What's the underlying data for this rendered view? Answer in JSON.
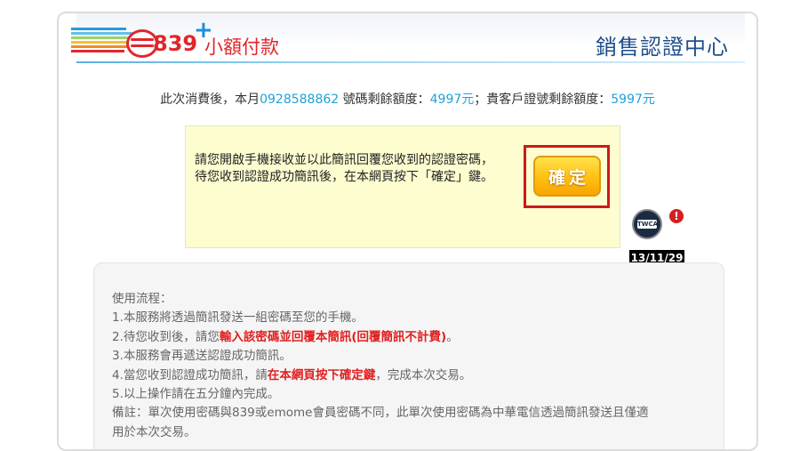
{
  "header": {
    "logo_number": "839",
    "logo_plus": "+",
    "logo_text": "小額付款",
    "title": "銷售認證中心"
  },
  "summary": {
    "prefix": "此次消費後，本月",
    "phone": "0928588862",
    "mid1": " 號碼剩餘額度：",
    "phone_remaining": "4997",
    "currency1": "元",
    "mid2": "；貴客戶證號剩餘額度：",
    "id_remaining": "5997",
    "currency2": "元"
  },
  "notice": {
    "line1": "請您開啟手機接收並以此簡訊回覆您收到的認證密碼，",
    "line2": "待您收到認證成功簡訊後，在本網頁按下「確定」鍵。",
    "confirm_label": "確定"
  },
  "badge": {
    "seal_text": "TWCA",
    "alert": "!",
    "date": "13/11/29"
  },
  "process": {
    "title": "使用流程：",
    "step1": "1.本服務將透過簡訊發送一組密碼至您的手機。",
    "step2_prefix": "2.待您收到後，請您",
    "step2_highlight": "輸入該密碼並回覆本簡訊(回覆簡訊不計費)",
    "step2_suffix": "。",
    "step3": "3.本服務會再遞送認證成功簡訊。",
    "step4_prefix": "4.當您收到認證成功簡訊，請",
    "step4_highlight": "在本網頁按下確定鍵",
    "step4_suffix": "，完成本次交易。",
    "step5": "5.以上操作請在五分鐘內完成。",
    "note_line1": "備註：單次使用密碼與839或emome會員密碼不同，此單次使用密碼為中華電信透過簡訊發送且僅適",
    "note_line2": "用於本次交易。"
  },
  "colors": {
    "brand_red": "#e1262c",
    "brand_blue": "#1e8fd8",
    "title_blue": "#1f4f8c",
    "highlight_red": "#e02020",
    "confirm_orange": "#ffbf12"
  }
}
